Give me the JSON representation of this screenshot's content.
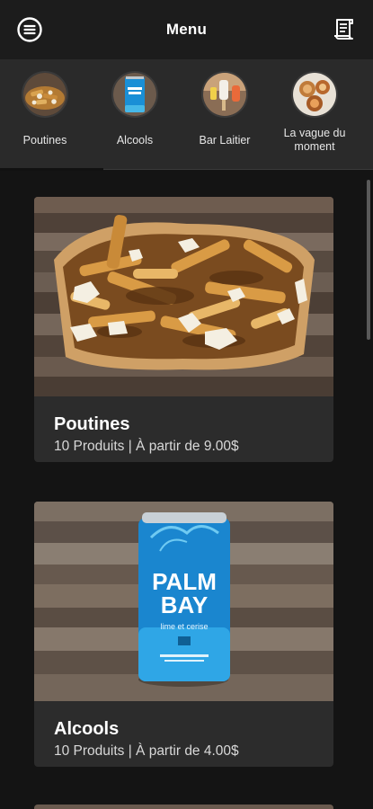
{
  "header": {
    "title": "Menu",
    "menu_icon": "hamburger-circle-icon",
    "receipt_icon": "receipt-icon"
  },
  "categories": [
    {
      "label": "Poutines",
      "icon": "poutine-thumbnail"
    },
    {
      "label": "Alcools",
      "icon": "can-thumbnail"
    },
    {
      "label": "Bar Laitier",
      "icon": "ice-cream-thumbnail"
    },
    {
      "label": "La vague du moment",
      "icon": "special-thumbnail"
    }
  ],
  "cards": [
    {
      "title": "Poutines",
      "subtitle": "10 Produits | À partir de 9.00$"
    },
    {
      "title": "Alcools",
      "subtitle": "10 Produits | À partir de 4.00$"
    }
  ],
  "can": {
    "brand_line1": "PALM",
    "brand_line2": "BAY",
    "flavor": "lime et cerise"
  },
  "colors": {
    "header_bg": "#1c1c1c",
    "strip_bg": "#2a2a2a",
    "card_bg": "#2c2c2c",
    "page_bg": "#141414"
  }
}
